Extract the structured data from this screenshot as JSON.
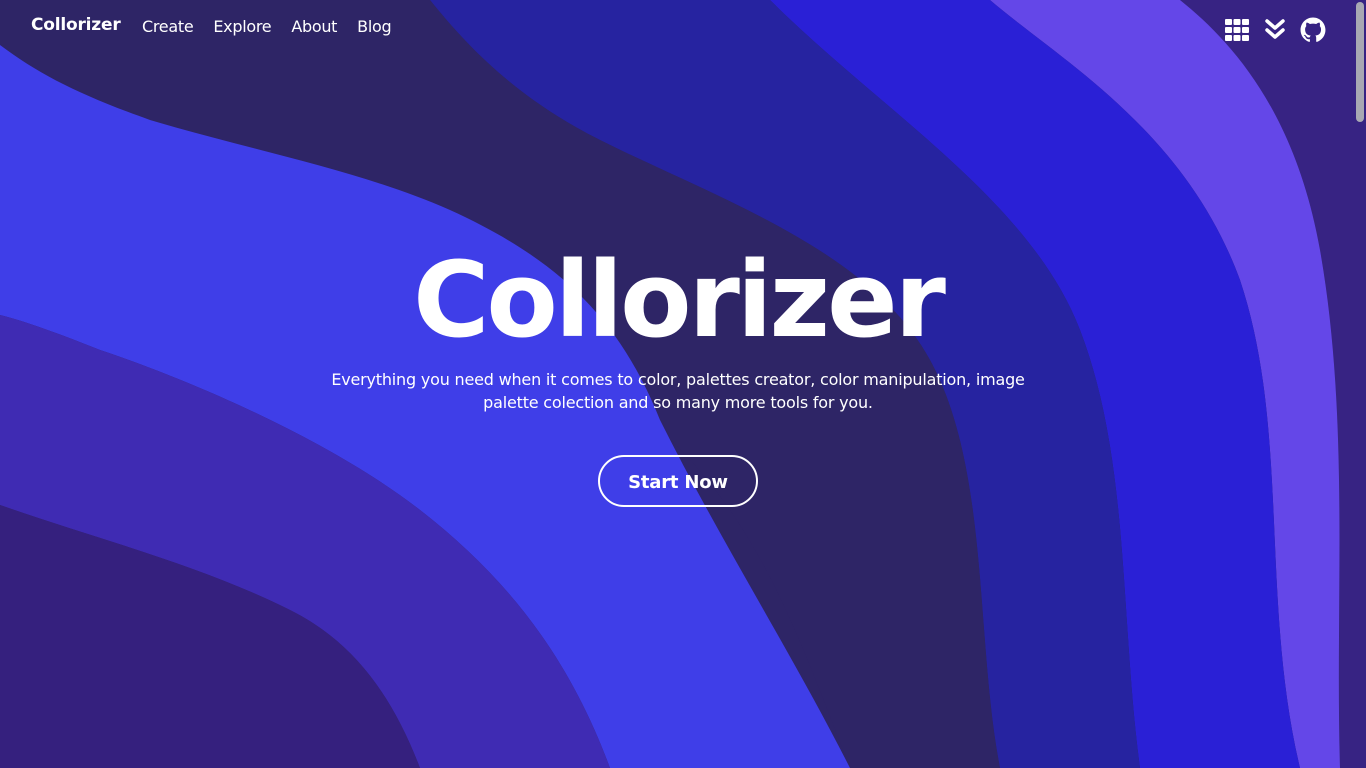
{
  "colors": {
    "background": "#2e2566",
    "band_left_dark": "#35207e",
    "band_left_mid": "#3f2bb3",
    "band_bright": "#3f3ee8",
    "band_navy": "#2e2566",
    "band_royal": "#2623a0",
    "band_electric": "#2a20d6",
    "band_violet": "#6447e8",
    "band_right_edge": "#372383",
    "text": "#ffffff"
  },
  "navbar": {
    "brand": "Collorizer",
    "links": [
      "Create",
      "Explore",
      "About",
      "Blog"
    ],
    "icons": [
      "grid-icon",
      "double-chevron-down-icon",
      "github-icon"
    ]
  },
  "hero": {
    "title": "Collorizer",
    "subtitle": "Everything you need when it comes to color, palettes creator, color manipulation, image palette colection and so many more tools for you.",
    "cta": "Start Now"
  }
}
